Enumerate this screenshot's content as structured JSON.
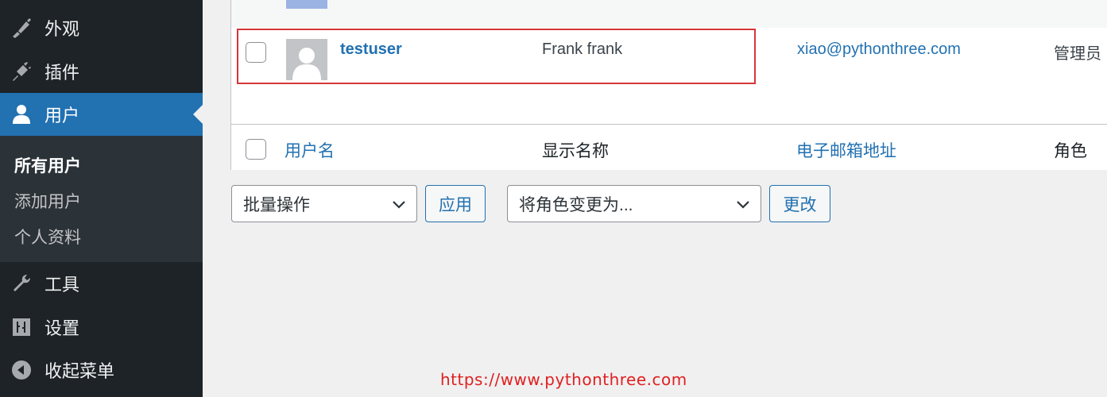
{
  "sidebar": {
    "items": [
      {
        "label": "外观",
        "icon": "appearance-brush-icon"
      },
      {
        "label": "插件",
        "icon": "plugins-icon"
      },
      {
        "label": "用户",
        "icon": "users-icon",
        "active": true
      },
      {
        "label": "工具",
        "icon": "tools-wrench-icon"
      },
      {
        "label": "设置",
        "icon": "settings-sliders-icon"
      },
      {
        "label": "收起菜单",
        "icon": "collapse-menu-icon"
      }
    ],
    "submenu": [
      {
        "label": "所有用户",
        "current": true
      },
      {
        "label": "添加用户"
      },
      {
        "label": "个人资料"
      }
    ]
  },
  "table": {
    "row": {
      "username": "testuser",
      "display_name": "Frank frank",
      "email": "xiao@pythonthree.com",
      "role": "管理员"
    },
    "footer_headers": {
      "username": "用户名",
      "display_name": "显示名称",
      "email": "电子邮箱地址",
      "role": "角色"
    }
  },
  "actions": {
    "bulk_select": "批量操作",
    "apply_button": "应用",
    "role_select": "将角色变更为...",
    "change_button": "更改"
  },
  "watermark": "https://www.pythonthree.com",
  "colors": {
    "sidebar_bg": "#1d2327",
    "accent": "#2271b1",
    "highlight_border": "#d63638",
    "watermark": "#e02020"
  }
}
